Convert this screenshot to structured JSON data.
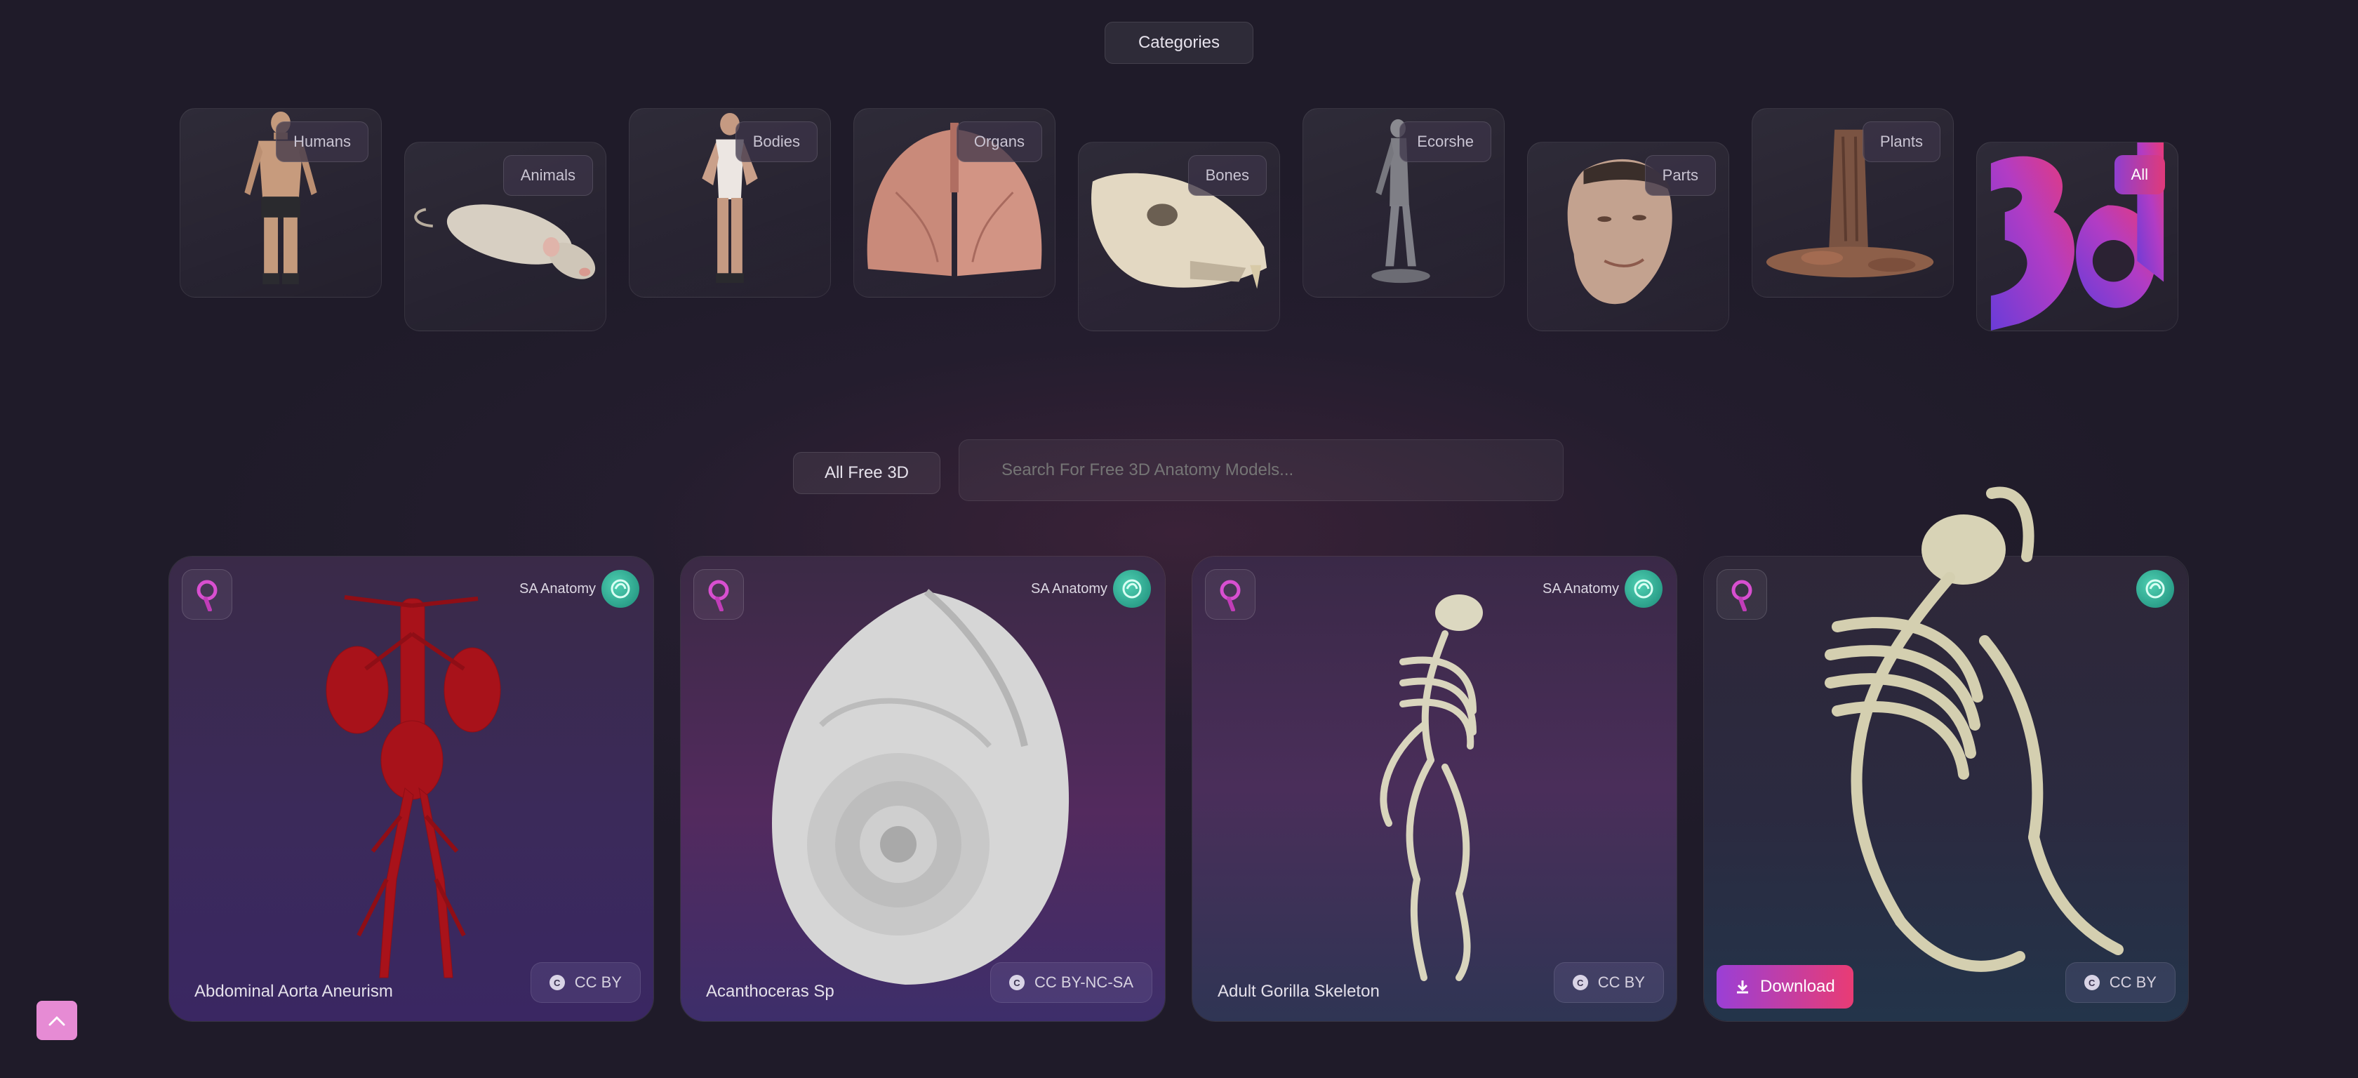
{
  "header": {
    "categories_button": "Categories"
  },
  "categories": [
    {
      "label": "Humans",
      "active": false
    },
    {
      "label": "Animals",
      "active": false
    },
    {
      "label": "Bodies",
      "active": false
    },
    {
      "label": "Organs",
      "active": false
    },
    {
      "label": "Bones",
      "active": false
    },
    {
      "label": "Ecorshe",
      "active": false
    },
    {
      "label": "Parts",
      "active": false
    },
    {
      "label": "Plants",
      "active": false
    },
    {
      "label": "All",
      "active": true
    }
  ],
  "filter": {
    "dropdown_label": "All Free 3D",
    "search_placeholder": "Search For Free 3D Anatomy Models..."
  },
  "models": [
    {
      "title": "Abdominal Aorta Aneurism",
      "author": "SA Anatomy",
      "license": "CC BY",
      "hovered": false,
      "icon": "vessels"
    },
    {
      "title": "Acanthoceras Sp",
      "author": "SA Anatomy",
      "license": "CC BY-NC-SA",
      "hovered": false,
      "icon": "ammonite"
    },
    {
      "title": "Adult Gorilla Skeleton",
      "author": "SA Anatomy",
      "license": "CC BY",
      "hovered": false,
      "icon": "skeleton"
    },
    {
      "title": "",
      "author": "",
      "license": "CC BY",
      "hovered": true,
      "download_label": "Download",
      "icon": "skeleton-large"
    }
  ],
  "colors": {
    "accent_gradient_start": "#9a3fd6",
    "accent_gradient_end": "#e93c74",
    "scroll_top_button": "#e68bd4",
    "author_avatar": "#2fae94"
  }
}
